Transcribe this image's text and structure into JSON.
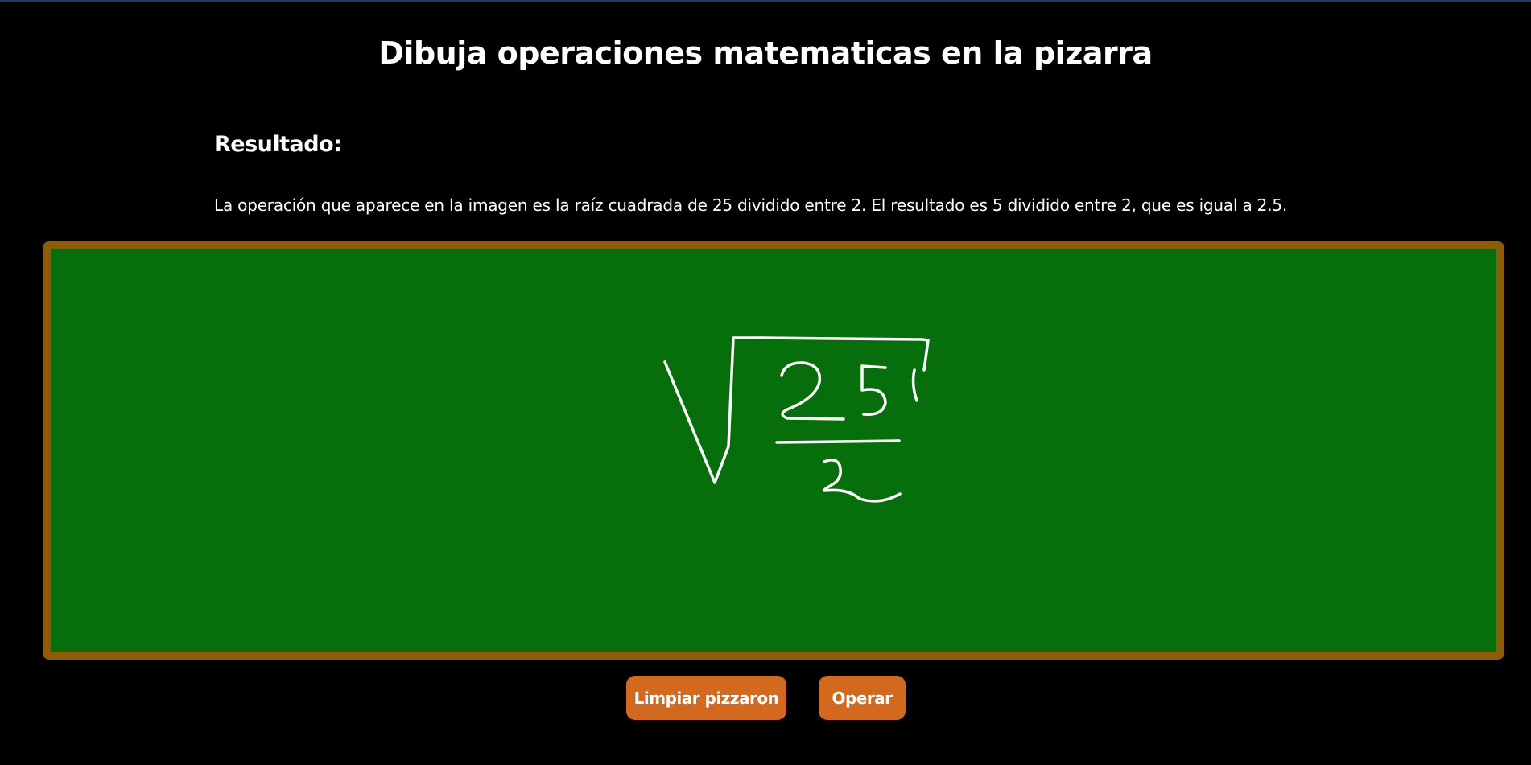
{
  "header": {
    "title": "Dibuja operaciones matematicas en la pizarra"
  },
  "result": {
    "heading": "Resultado:",
    "text": "La operación que aparece en la imagen es la raíz cuadrada de 25 dividido entre 2. El resultado es 5 dividido entre 2, que es igual a 2.5."
  },
  "board": {
    "drawing": "square-root-of-25-over-2-sketch",
    "colors": {
      "surface": "#066e0a",
      "frame": "#8a5c0c",
      "chalk": "#ffffff"
    }
  },
  "buttons": {
    "clear_label": "Limpiar pizzaron",
    "operate_label": "Operar",
    "color": "#d2691e"
  }
}
